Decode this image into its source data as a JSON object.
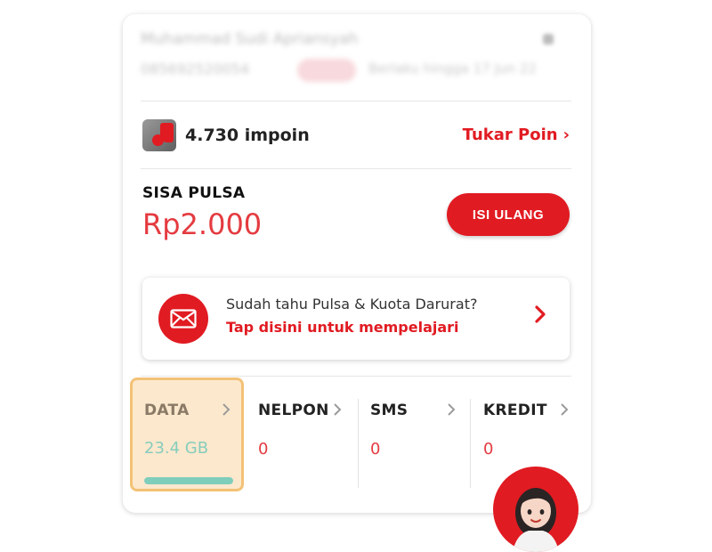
{
  "profile": {
    "name": "Muhammad Sudi Apriansyah",
    "phone": "085692520054",
    "validity": "Berlaku hingga 17 Jun 22"
  },
  "points": {
    "amount": "4.730 impoin",
    "redeem_label": "Tukar Poin",
    "redeem_chevron": "›"
  },
  "balance": {
    "label": "SISA PULSA",
    "value": "Rp2.000",
    "topup_label": "ISI ULANG"
  },
  "emergency": {
    "question": "Sudah tahu Pulsa & Kuota Darurat?",
    "link": "Tap disini untuk mempelajari",
    "icon": "envelope-icon"
  },
  "quotas": [
    {
      "label": "DATA",
      "value": "23.4 GB",
      "usage_fraction": 1.0
    },
    {
      "label": "NELPON",
      "value": "0"
    },
    {
      "label": "SMS",
      "value": "0"
    },
    {
      "label": "KREDIT",
      "value": "0"
    }
  ],
  "colors": {
    "brand_red": "#e11b22",
    "value_red": "#e43b40",
    "data_highlight_bg": "#fce8cd",
    "data_highlight_border": "#f3c276",
    "data_teal": "#7fcdbb"
  }
}
